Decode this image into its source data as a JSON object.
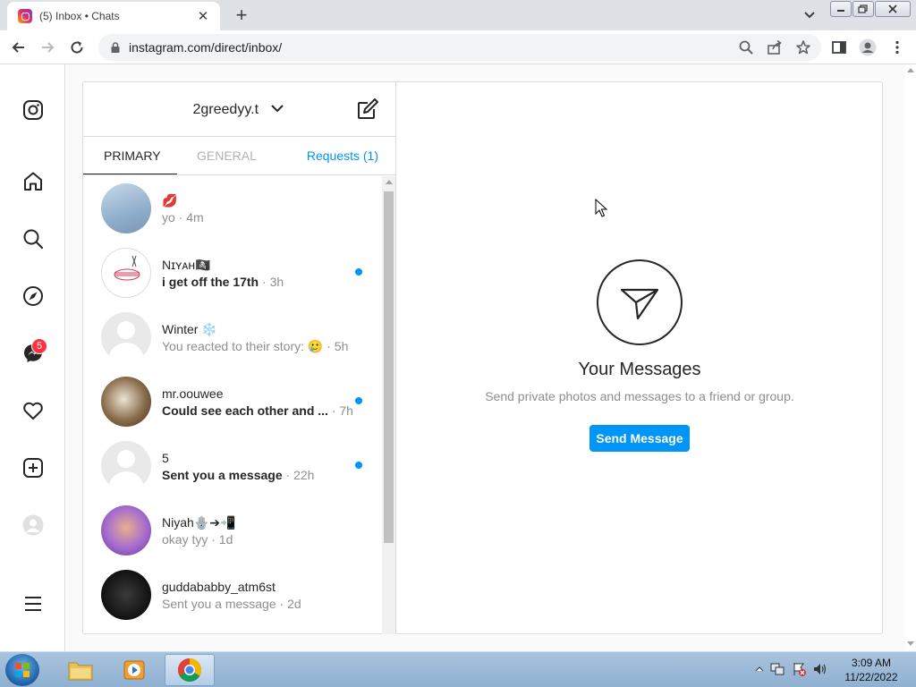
{
  "browser": {
    "tab_title": "(5) Inbox • Chats",
    "new_tab": "+",
    "close_tab": "✕",
    "url": "instagram.com/direct/inbox/"
  },
  "rail": {
    "messages_badge": "5"
  },
  "inbox": {
    "account": "2greedyy.t",
    "tabs": {
      "primary": "PRIMARY",
      "general": "GENERAL",
      "requests": "Requests (1)"
    },
    "threads": [
      {
        "name": "💋",
        "message": "yo",
        "time": " · 4m",
        "unread": false,
        "avatar": "photo-blue"
      },
      {
        "name": "Nɪʏᴀʜ🏴‍☠️",
        "message": "i get off the 17th",
        "time": " · 3h",
        "unread": true,
        "avatar": "photo-logo"
      },
      {
        "name": "Winter ❄️",
        "message": "You reacted to their story: 🥲",
        "time": " · 5h",
        "unread": false,
        "avatar": "blank"
      },
      {
        "name": "mr.oouwee",
        "message": "Could see each other and ...",
        "time": " · 7h",
        "unread": true,
        "avatar": "photo-dark"
      },
      {
        "name": "5",
        "message": "Sent you a message",
        "time": " · 22h",
        "unread": true,
        "avatar": "blank"
      },
      {
        "name": "Niyah🪬➔📲",
        "message": "okay tyy",
        "time": " · 1d",
        "unread": false,
        "avatar": "photo-purple"
      },
      {
        "name": "guddababby_atm6st",
        "message": "Sent you a message",
        "time": " · 2d",
        "unread": false,
        "avatar": "photo-black"
      }
    ]
  },
  "empty_state": {
    "title": "Your Messages",
    "subtitle": "Send private photos and messages to a friend or group.",
    "button": "Send Message"
  },
  "taskbar": {
    "time": "3:09 AM",
    "date": "11/22/2022"
  },
  "colors": {
    "accent": "#0095f6",
    "badge": "#ff3040"
  }
}
